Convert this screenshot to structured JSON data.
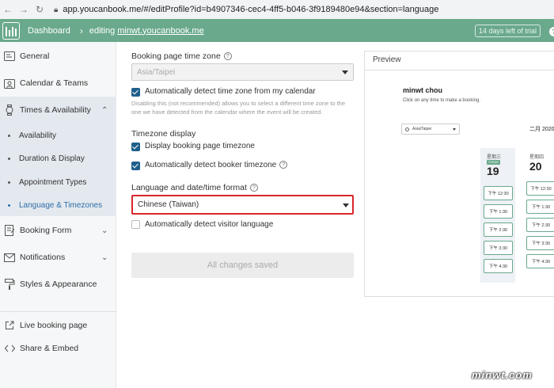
{
  "browser": {
    "url": "app.youcanbook.me/#/editProfile?id=b4907346-cec4-4ff5-b046-3f9189480e94&section=language"
  },
  "header": {
    "dashboard": "Dashboard",
    "editing_prefix": "editing",
    "profile_link": "minwt.youcanbook.me",
    "trial": "14 days left of trial",
    "help": "?"
  },
  "sidebar": {
    "general": "General",
    "calendar_teams": "Calendar & Teams",
    "times_availability": "Times & Availability",
    "sub": [
      "Availability",
      "Duration & Display",
      "Appointment Types",
      "Language & Timezones"
    ],
    "booking_form": "Booking Form",
    "notifications": "Notifications",
    "styles_appearance": "Styles & Appearance",
    "live_booking": "Live booking page",
    "share_embed": "Share & Embed"
  },
  "form": {
    "tz_label": "Booking page time zone",
    "tz_value": "Asia/Taipei",
    "auto_detect_tz": "Automatically detect time zone from my calendar",
    "auto_detect_help": "Disabling this (not recommended) allows you to select a different time zone to the one we have detected from the calendar where the event will be created.",
    "tz_display_label": "Timezone display",
    "display_booking_tz": "Display booking page timezone",
    "auto_detect_booker_tz": "Automatically detect booker timezone",
    "lang_label": "Language and date/time format",
    "lang_value": "Chinese (Taiwan)",
    "auto_detect_visitor_lang": "Automatically detect visitor language",
    "save": "All changes saved"
  },
  "preview": {
    "title": "Preview",
    "name": "minwt chou",
    "subtitle": "Click on any time to make a booking.",
    "tz": "Asia/Taipei",
    "month": "二月 2020",
    "days": [
      {
        "dow": "星期三",
        "badge": "TODAY",
        "date": "19",
        "slots": [
          "下午 12:30",
          "下午 1:30",
          "下午 2:30",
          "下午 3:30",
          "下午 4:30"
        ]
      },
      {
        "dow": "星期四",
        "date": "20",
        "slots": [
          "下午 12:30",
          "下午 1:30",
          "下午 2:30",
          "下午 3:30",
          "下午 4:30"
        ]
      }
    ]
  },
  "watermark": "minwt.com"
}
